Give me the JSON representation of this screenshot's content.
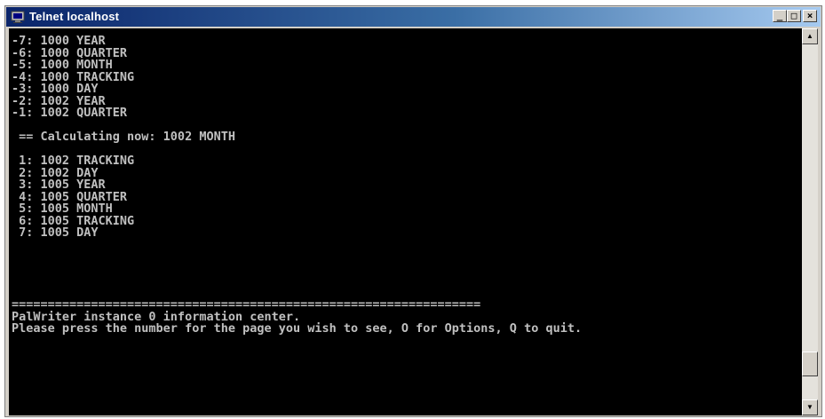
{
  "window": {
    "title": "Telnet localhost",
    "minimize_glyph": "_",
    "maximize_glyph": "□",
    "close_glyph": "×"
  },
  "console": {
    "lines": [
      "-7: 1000 YEAR",
      "-6: 1000 QUARTER",
      "-5: 1000 MONTH",
      "-4: 1000 TRACKING",
      "-3: 1000 DAY",
      "-2: 1002 YEAR",
      "-1: 1002 QUARTER",
      "",
      " == Calculating now: 1002 MONTH",
      "",
      " 1: 1002 TRACKING",
      " 2: 1002 DAY",
      " 3: 1005 YEAR",
      " 4: 1005 QUARTER",
      " 5: 1005 MONTH",
      " 6: 1005 TRACKING",
      " 7: 1005 DAY",
      "",
      "",
      "",
      "",
      "",
      "=================================================================",
      "PalWriter instance 0 information center.",
      "Please press the number for the page you wish to see, O for Options, Q to quit."
    ]
  },
  "scrollbar": {
    "up_glyph": "▲",
    "down_glyph": "▼",
    "position": 0.93
  },
  "colors": {
    "console_bg": "#000000",
    "console_text": "#c0c0c0",
    "title_active": "#0a246a"
  },
  "icons": {
    "title_icon": "telnet-console-icon"
  }
}
